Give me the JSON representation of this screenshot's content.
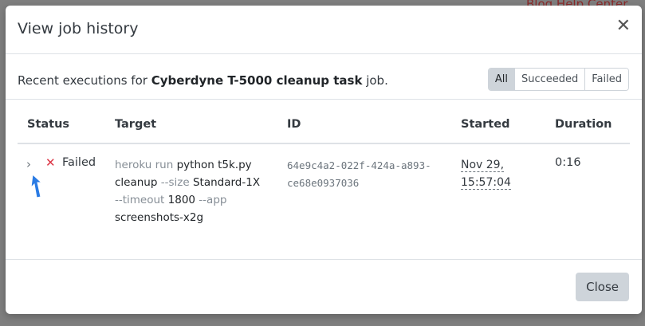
{
  "background": {
    "top_links": "Blog   Help Center"
  },
  "modal": {
    "title": "View job history",
    "intro_prefix": "Recent executions for ",
    "job_name": "Cyberdyne T-5000 cleanup task",
    "intro_suffix": " job.",
    "filters": [
      "All",
      "Succeeded",
      "Failed"
    ],
    "active_filter": "All",
    "columns": [
      "Status",
      "Target",
      "ID",
      "Started",
      "Duration"
    ],
    "rows": [
      {
        "status": "Failed",
        "target": {
          "p1": "heroku run ",
          "p2": "python t5k.py cleanup",
          "p3": " --size ",
          "p4": "Standard-1X",
          "p5": " --timeout ",
          "p6": "1800",
          "p7": " --app ",
          "p8": "screenshots-x2g"
        },
        "id_line1": "64e9c4a2-022f-424a-a893-",
        "id_line2": "ce68e0937036",
        "started_line1": "Nov 29,",
        "started_line2": "15:57:04",
        "duration": "0:16"
      }
    ],
    "close_label": "Close"
  },
  "icons": {
    "close": "close-icon",
    "expand": "chevron-right-icon",
    "failed": "x-mark-icon",
    "cursor": "pointer-arrow-icon"
  },
  "colors": {
    "failed": "#dc3545",
    "cursor": "#2a7be4"
  }
}
